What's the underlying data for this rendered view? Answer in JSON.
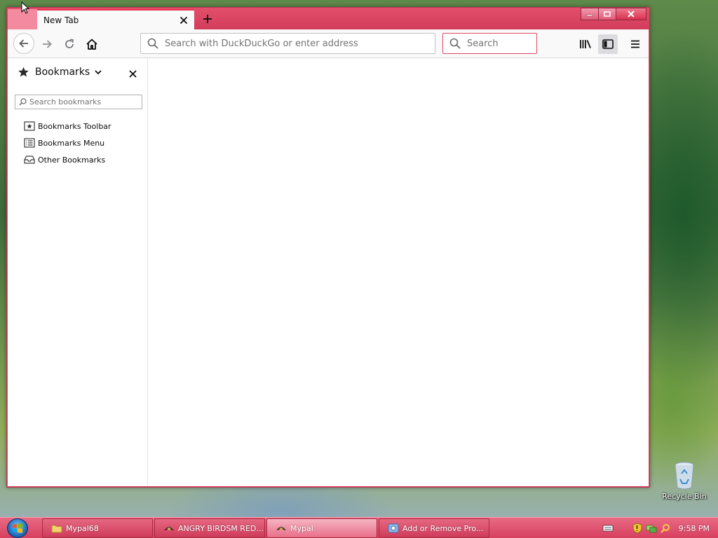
{
  "browser": {
    "tab": {
      "title": "New Tab"
    },
    "urlbar": {
      "placeholder": "Search with DuckDuckGo or enter address",
      "value": ""
    },
    "searchbar": {
      "placeholder": "Search",
      "value": ""
    }
  },
  "sidebar": {
    "title": "Bookmarks",
    "search_placeholder": "Search bookmarks",
    "items": [
      {
        "label": "Bookmarks Toolbar",
        "icon": "bookmarks-toolbar-icon"
      },
      {
        "label": "Bookmarks Menu",
        "icon": "bookmarks-menu-icon"
      },
      {
        "label": "Other Bookmarks",
        "icon": "other-bookmarks-icon"
      }
    ]
  },
  "desktop": {
    "recycle_bin_label": "Recycle Bin"
  },
  "taskbar": {
    "buttons": [
      {
        "label": "Mypal68",
        "icon": "folder-icon"
      },
      {
        "label": "ANGRY BIRDSM RED...",
        "icon": "mypal-icon"
      },
      {
        "label": "Mypal",
        "icon": "mypal-icon",
        "active": true
      },
      {
        "label": "Add or Remove Pro...",
        "icon": "control-panel-icon"
      }
    ],
    "clock": "9:58 PM"
  },
  "colors": {
    "accent": "#e2536d",
    "taskbar": "#d7405f",
    "search_focus_border": "#e04a66"
  }
}
